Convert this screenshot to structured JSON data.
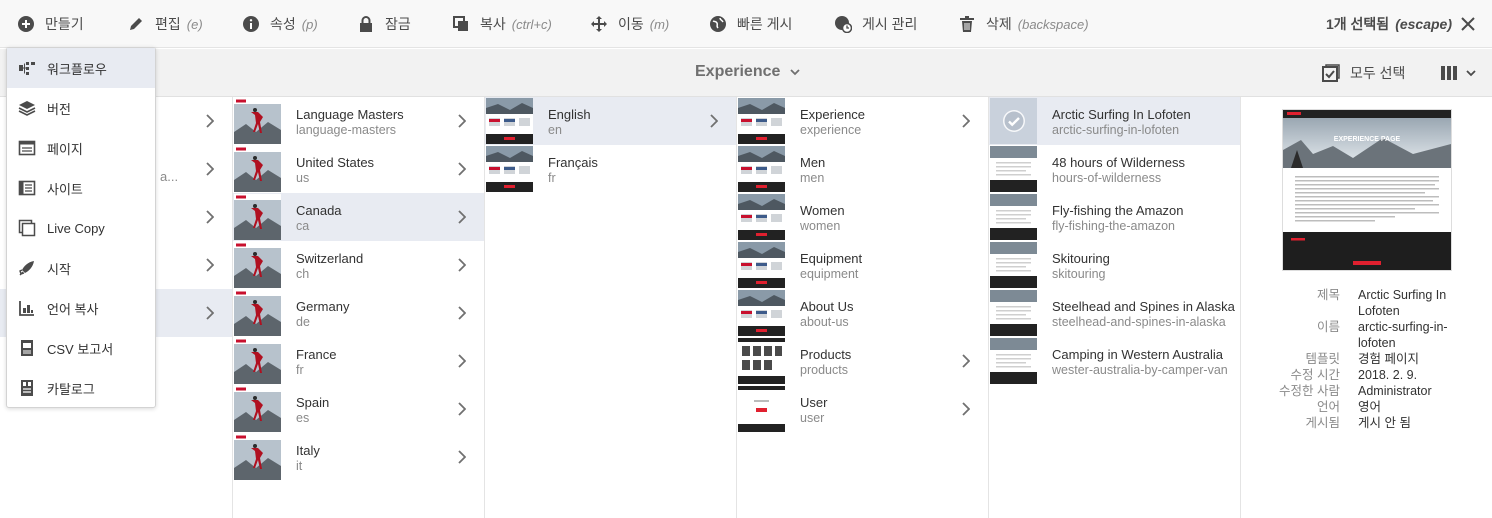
{
  "toolbar": {
    "create_label": "만들기",
    "edit_label": "편집",
    "edit_shortcut": "(e)",
    "props_label": "속성",
    "props_shortcut": "(p)",
    "lock_label": "잠금",
    "copy_label": "복사",
    "copy_shortcut": "(ctrl+c)",
    "move_label": "이동",
    "move_shortcut": "(m)",
    "quick_publish_label": "빠른 게시",
    "manage_publication_label": "게시 관리",
    "delete_label": "삭제",
    "delete_shortcut": "(backspace)",
    "selection_label": "1개 선택됨",
    "selection_shortcut": "(escape)"
  },
  "subbar": {
    "title": "Experience",
    "select_all_label": "모두 선택"
  },
  "create_menu": {
    "items": [
      {
        "label": "워크플로우",
        "icon": "workflow-icon"
      },
      {
        "label": "버전",
        "icon": "layers-icon"
      },
      {
        "label": "페이지",
        "icon": "page-icon"
      },
      {
        "label": "사이트",
        "icon": "site-icon"
      },
      {
        "label": "Live Copy",
        "icon": "live-copy-icon"
      },
      {
        "label": "시작",
        "icon": "launch-icon"
      },
      {
        "label": "언어 복사",
        "icon": "language-copy-icon"
      },
      {
        "label": "CSV 보고서",
        "icon": "csv-report-icon"
      },
      {
        "label": "카탈로그",
        "icon": "catalog-icon"
      }
    ]
  },
  "column0": {
    "partial_text": "a..."
  },
  "column1": [
    {
      "title": "Language Masters",
      "name": "language-masters"
    },
    {
      "title": "United States",
      "name": "us"
    },
    {
      "title": "Canada",
      "name": "ca"
    },
    {
      "title": "Switzerland",
      "name": "ch"
    },
    {
      "title": "Germany",
      "name": "de"
    },
    {
      "title": "France",
      "name": "fr"
    },
    {
      "title": "Spain",
      "name": "es"
    },
    {
      "title": "Italy",
      "name": "it"
    }
  ],
  "column2": [
    {
      "title": "English",
      "name": "en"
    },
    {
      "title": "Français",
      "name": "fr"
    }
  ],
  "column3": [
    {
      "title": "Experience",
      "name": "experience"
    },
    {
      "title": "Men",
      "name": "men"
    },
    {
      "title": "Women",
      "name": "women"
    },
    {
      "title": "Equipment",
      "name": "equipment"
    },
    {
      "title": "About Us",
      "name": "about-us"
    },
    {
      "title": "Products",
      "name": "products"
    },
    {
      "title": "User",
      "name": "user"
    }
  ],
  "column4": [
    {
      "title": "Arctic Surfing In Lofoten",
      "name": "arctic-surfing-in-lofoten"
    },
    {
      "title": "48 hours of Wilderness",
      "name": "hours-of-wilderness"
    },
    {
      "title": "Fly-fishing the Amazon",
      "name": "fly-fishing-the-amazon"
    },
    {
      "title": "Skitouring",
      "name": "skitouring"
    },
    {
      "title": "Steelhead and Spines in Alaska",
      "name": "steelhead-and-spines-in-alaska"
    },
    {
      "title": "Camping in Western Australia",
      "name": "wester-australia-by-camper-van"
    }
  ],
  "preview": {
    "banner_text": "EXPERIENCE PAGE"
  },
  "meta": [
    {
      "key": "제목",
      "value": "Arctic Surfing In Lofoten"
    },
    {
      "key": "이름",
      "value": "arctic-surfing-in-lofoten"
    },
    {
      "key": "템플릿",
      "value": "경험 페이지"
    },
    {
      "key": "수정 시간",
      "value": "2018. 2. 9."
    },
    {
      "key": "수정한 사람",
      "value": "Administrator"
    },
    {
      "key": "언어",
      "value": "영어"
    },
    {
      "key": "게시됨",
      "value": "게시 안 됨"
    }
  ],
  "colors": {
    "accent": "#e8ebf2",
    "brand_red": "#e0202f",
    "icon": "#4b4b4b"
  }
}
